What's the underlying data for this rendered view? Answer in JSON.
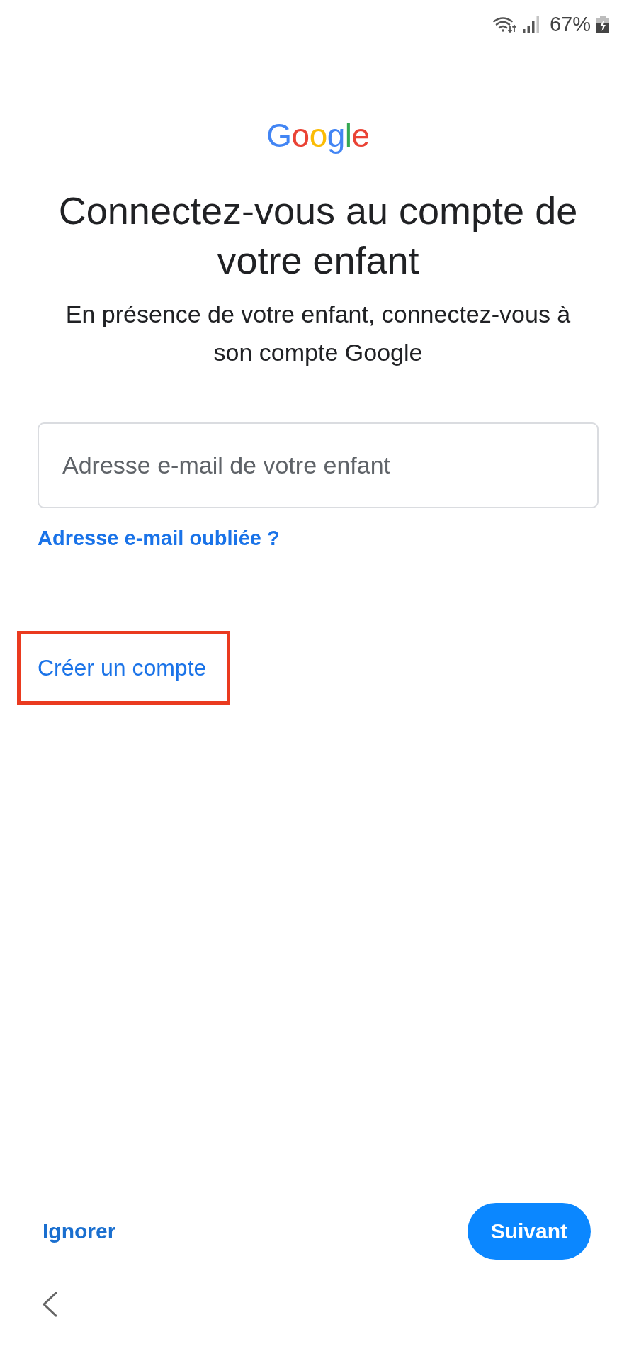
{
  "status_bar": {
    "battery": "67%"
  },
  "header": {
    "logo": "Google",
    "title": "Connectez-vous au compte de votre enfant",
    "subtitle": "En présence de votre enfant, connectez-vous à son compte Google"
  },
  "email_field": {
    "placeholder": "Adresse e-mail de votre enfant"
  },
  "forgot_email_link": {
    "label": "Adresse e-mail oubliée ?"
  },
  "create_account_link": {
    "label": "Créer un compte",
    "highlighted": true
  },
  "footer": {
    "skip_button": "Ignorer",
    "next_button": "Suivant"
  }
}
